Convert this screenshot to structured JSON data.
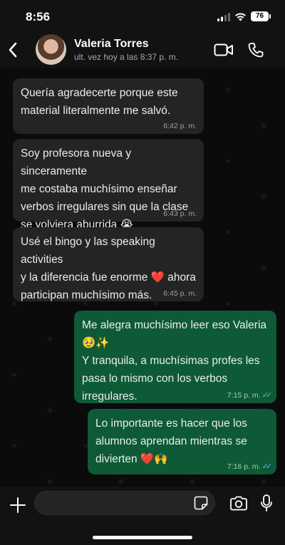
{
  "status_bar": {
    "time": "8:56",
    "battery": "76"
  },
  "header": {
    "contact_name": "Valeria Torres",
    "last_seen": "ult. vez hoy a las 8:37 p. m."
  },
  "messages": [
    {
      "direction": "incoming",
      "text": "Quería agradecerte porque este\nmaterial literalmente me salvó.",
      "time": "6:42 p. m."
    },
    {
      "direction": "incoming",
      "text": "Soy profesora nueva y sinceramente\nme costaba muchísimo enseñar\nverbos irregulares sin que la clase\nse volviera aburrida 😭",
      "time": "6:43 p. m."
    },
    {
      "direction": "incoming",
      "text": "Usé el bingo y las speaking activities\ny la diferencia fue enorme ❤️ ahora\nparticipan muchísimo más.",
      "time": "6:45 p. m."
    },
    {
      "direction": "outgoing",
      "text": "Me alegra muchísimo leer eso Valeria\n🥹✨\nY tranquila, a muchísimas profes les\npasa lo mismo con los verbos\nirregulares.",
      "time": "7:15 p. m.",
      "read": true
    },
    {
      "direction": "outgoing",
      "text": "Lo importante es hacer que los\nalumnos aprendan mientras se\ndivierten ❤️🙌",
      "time": "7:16 p. m.",
      "read": true
    }
  ],
  "input": {
    "value": ""
  },
  "colors": {
    "incoming_bubble": "#242424",
    "outgoing_bubble": "#0e5a36",
    "read_ticks": "#53bdeb"
  },
  "icons": [
    "back-icon",
    "video-call-icon",
    "phone-icon",
    "plus-icon",
    "sticker-icon",
    "camera-icon",
    "microphone-icon"
  ]
}
